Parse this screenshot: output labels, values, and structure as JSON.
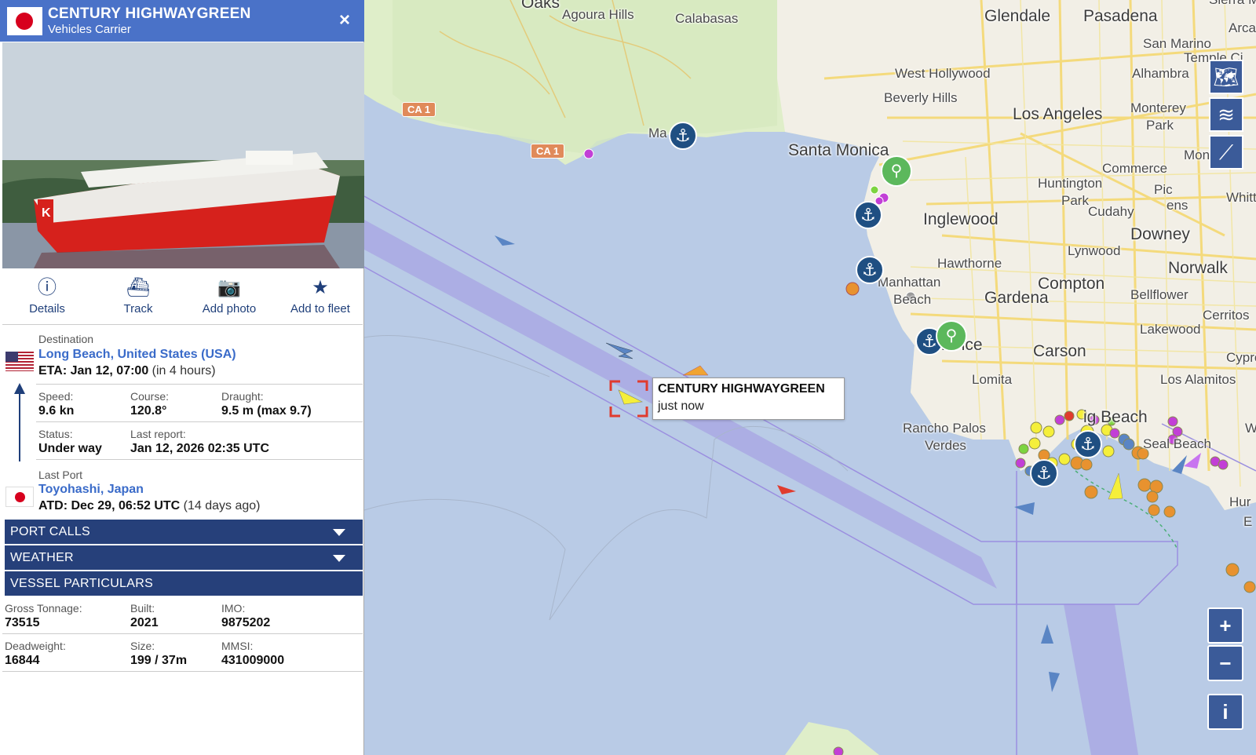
{
  "vessel": {
    "name": "CENTURY HIGHWAYGREEN",
    "type": "Vehicles Carrier",
    "close_label": "×"
  },
  "actions": [
    {
      "label": "Details",
      "icon": "info-icon"
    },
    {
      "label": "Track",
      "icon": "ship-track-icon"
    },
    {
      "label": "Add photo",
      "icon": "camera-icon"
    },
    {
      "label": "Add to fleet",
      "icon": "star-icon"
    }
  ],
  "voyage": {
    "destination_label": "Destination",
    "destination": "Long Beach, United States (USA)",
    "eta": "ETA: Jan 12, 07:00",
    "eta_rel": "(in 4 hours)",
    "speed_label": "Speed:",
    "speed": "9.6 kn",
    "course_label": "Course:",
    "course": "120.8°",
    "draught_label": "Draught:",
    "draught": "9.5 m (max 9.7)",
    "status_label": "Status:",
    "status": "Under way",
    "last_report_label": "Last report:",
    "last_report": "Jan 12, 2026 02:35 UTC",
    "last_port_label": "Last Port",
    "last_port": "Toyohashi, Japan",
    "atd": "ATD: Dec 29, 06:52 UTC",
    "atd_rel": "(14 days ago)"
  },
  "sections": {
    "port_calls": "PORT CALLS",
    "weather": "WEATHER",
    "particulars": "VESSEL PARTICULARS"
  },
  "particulars": {
    "gt_label": "Gross Tonnage:",
    "gt": "73515",
    "built_label": "Built:",
    "built": "2021",
    "imo_label": "IMO:",
    "imo": "9875202",
    "dwt_label": "Deadweight:",
    "dwt": "16844",
    "size_label": "Size:",
    "size": "199 / 37m",
    "mmsi_label": "MMSI:",
    "mmsi": "431009000"
  },
  "map": {
    "tooltip_name": "CENTURY HIGHWAYGREEN",
    "tooltip_time": "just now",
    "places": {
      "oaks": "Oaks",
      "agoura": "Agoura Hills",
      "calabasas": "Calabasas",
      "glendale": "Glendale",
      "pasadena": "Pasadena",
      "sierra": "Sierra Madre",
      "arcadia": "Arcad",
      "sanmarino": "San Marino",
      "temple": "Temple Ci",
      "alhambra": "Alhambra",
      "westhollywood": "West Hollywood",
      "beverly": "Beverly Hills",
      "losangeles": "Los Angeles",
      "monterey": "Monterey",
      "park": "Park",
      "malibu": "Ma",
      "santamonica": "Santa Monica",
      "montebello": "Montebel",
      "commerce": "Commerce",
      "huntington": "Huntington",
      "park2": "Park",
      "pico": "Pic",
      "rivera": "ens",
      "whitt": "Whitt",
      "cudahy": "Cudahy",
      "inglewood": "Inglewood",
      "downey": "Downey",
      "lynwood": "Lynwood",
      "hawthorne": "Hawthorne",
      "norwalk": "Norwalk",
      "manhattan": "Manhattan",
      "beach": "Beach",
      "compton": "Compton",
      "gardena": "Gardena",
      "bellflower": "Bellflower",
      "cerritos": "Cerritos",
      "lakewood": "Lakewood",
      "torrance": "rrance",
      "carson": "Carson",
      "cypress": "Cypre",
      "lomita": "Lomita",
      "losalamitos": "Los Alamitos",
      "longbeach": "ig Beach",
      "ranchopv": "Rancho Palos",
      "verdes": "Verdes",
      "sealbeach": "Seal Beach",
      "hun": "Hur",
      "e": "E",
      "w": "W"
    },
    "hwy1": "CA 1",
    "hwy2": "CA 1",
    "zoom_in": "+",
    "zoom_out": "−",
    "info": "i"
  }
}
